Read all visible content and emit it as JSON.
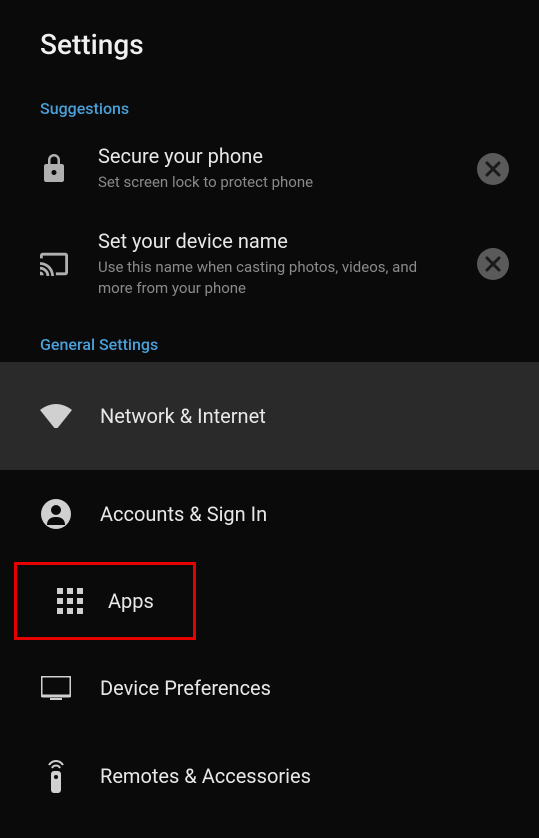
{
  "header": {
    "title": "Settings"
  },
  "sections": {
    "suggestions": {
      "header": "Suggestions",
      "items": [
        {
          "title": "Secure your phone",
          "subtitle": "Set screen lock to protect phone"
        },
        {
          "title": "Set your device name",
          "subtitle": "Use this name when casting photos, videos, and more from your phone"
        }
      ]
    },
    "general": {
      "header": "General Settings",
      "items": [
        {
          "label": "Network & Internet"
        },
        {
          "label": "Accounts & Sign In"
        },
        {
          "label": "Apps"
        },
        {
          "label": "Device Preferences"
        },
        {
          "label": "Remotes & Accessories"
        }
      ]
    }
  }
}
